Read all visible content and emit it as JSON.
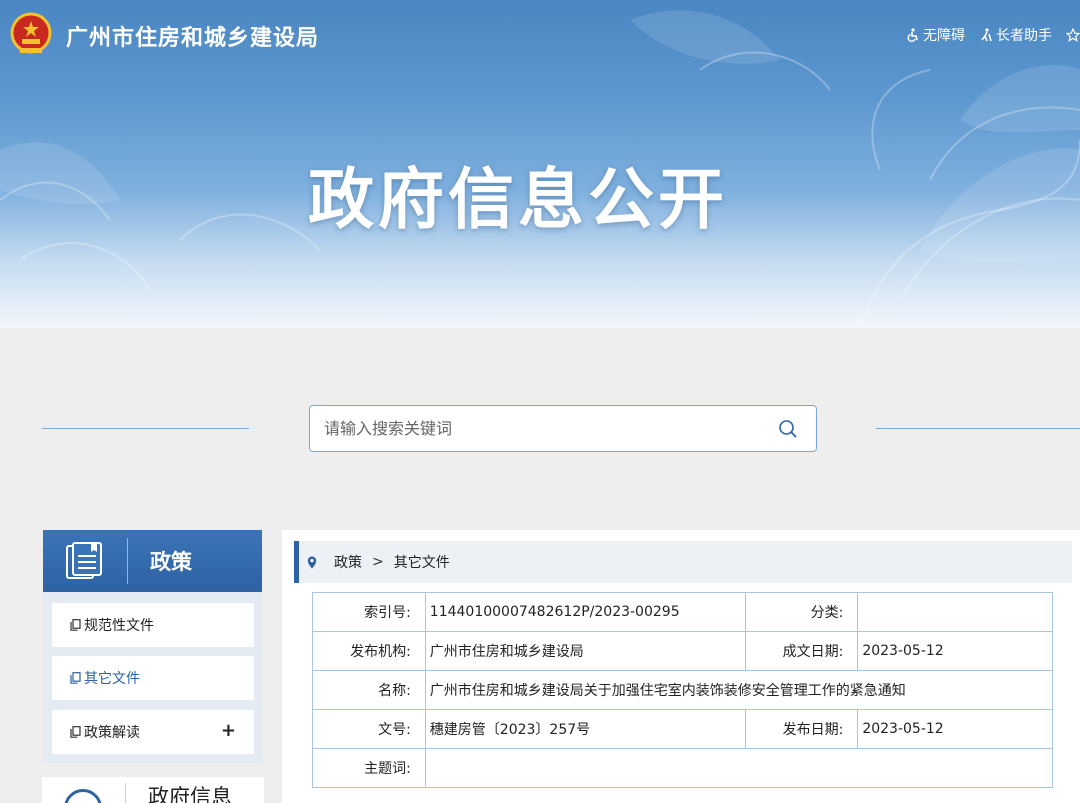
{
  "header": {
    "site_name": "广州市住房和城乡建设局",
    "tools": [
      {
        "label": "无障碍",
        "icon": "wheelchair-icon"
      },
      {
        "label": "长者助手",
        "icon": "elder-icon"
      },
      {
        "label": "",
        "icon": "star-icon"
      }
    ]
  },
  "banner": {
    "title": "政府信息公开"
  },
  "search": {
    "placeholder": "请输入搜索关键词",
    "value": ""
  },
  "sidebar": {
    "section_title": "政策",
    "items": [
      {
        "label": "规范性文件",
        "active": false
      },
      {
        "label": "其它文件",
        "active": true
      },
      {
        "label": "政策解读",
        "expandable": true,
        "expand_symbol": "+"
      }
    ],
    "section2_title": "政府信息"
  },
  "breadcrumb": {
    "items": [
      "政策",
      "其它文件"
    ]
  },
  "document": {
    "index_label": "索引号:",
    "index_value": "11440100007482612P/2023-00295",
    "category_label": "分类:",
    "category_value": "",
    "issuer_label": "发布机构:",
    "issuer_value": "广州市住房和城乡建设局",
    "written_date_label": "成文日期:",
    "written_date_value": "2023-05-12",
    "name_label": "名称:",
    "name_value": "广州市住房和城乡建设局关于加强住宅室内装饰装修安全管理工作的紧急通知",
    "doc_no_label": "文号:",
    "doc_no_value": "穗建房管〔2023〕257号",
    "publish_date_label": "发布日期:",
    "publish_date_value": "2023-05-12",
    "keywords_label": "主题词:",
    "keywords_value": ""
  },
  "colors": {
    "primary": "#2d62a4",
    "banner_blue": "#4a86c2",
    "border_blue": "#a9c6e2"
  }
}
